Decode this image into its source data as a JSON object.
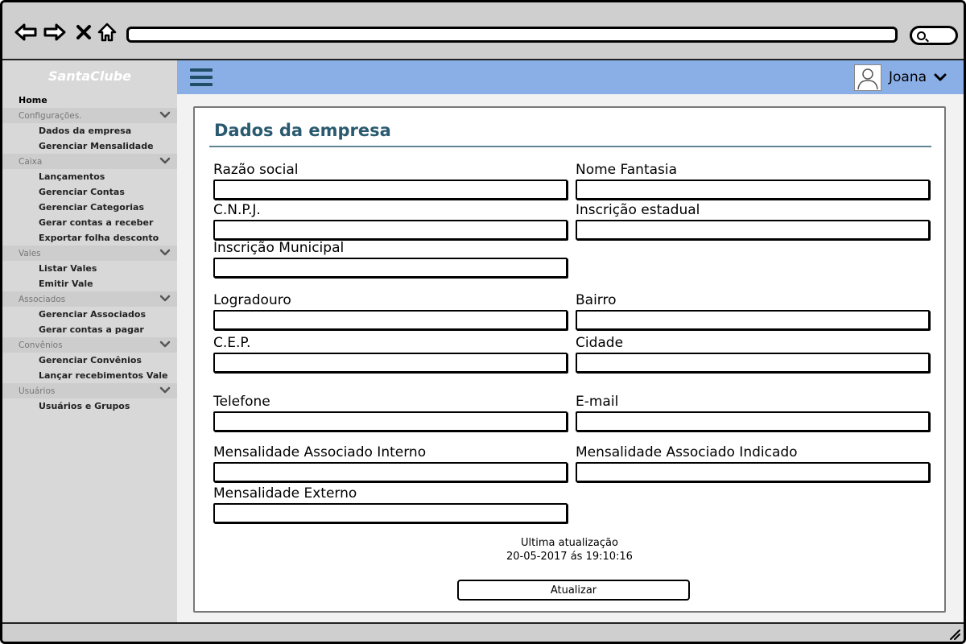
{
  "app": {
    "brand": "SantaClube"
  },
  "browser": {
    "url": ""
  },
  "user": {
    "name": "Joana"
  },
  "sidebar": {
    "items": [
      {
        "label": "Home",
        "type": "top"
      },
      {
        "label": "Configurações.",
        "type": "section",
        "expandable": true
      },
      {
        "label": "Dados da empresa",
        "type": "sub"
      },
      {
        "label": "Gerenciar Mensalidade",
        "type": "sub"
      },
      {
        "label": "Caixa",
        "type": "section",
        "expandable": true
      },
      {
        "label": "Lançamentos",
        "type": "sub"
      },
      {
        "label": "Gerenciar Contas",
        "type": "sub"
      },
      {
        "label": "Gerenciar Categorias",
        "type": "sub"
      },
      {
        "label": "Gerar contas a receber",
        "type": "sub"
      },
      {
        "label": "Exportar folha desconto",
        "type": "sub"
      },
      {
        "label": "Vales",
        "type": "section",
        "expandable": true
      },
      {
        "label": "Listar Vales",
        "type": "sub"
      },
      {
        "label": "Emitir Vale",
        "type": "sub"
      },
      {
        "label": "Associados",
        "type": "section",
        "expandable": true
      },
      {
        "label": "Gerenciar Associados",
        "type": "sub"
      },
      {
        "label": "Gerar contas a pagar",
        "type": "sub"
      },
      {
        "label": "Convênios",
        "type": "section",
        "expandable": true
      },
      {
        "label": "Gerenciar Convênios",
        "type": "sub"
      },
      {
        "label": "Lançar recebimentos Vale",
        "type": "sub"
      },
      {
        "label": "Usuários",
        "type": "section",
        "expandable": true
      },
      {
        "label": "Usuários e Grupos",
        "type": "sub"
      }
    ]
  },
  "form": {
    "title": "Dados da empresa",
    "fields": {
      "razao_social": {
        "label": "Razão social",
        "value": ""
      },
      "nome_fantasia": {
        "label": "Nome Fantasia",
        "value": ""
      },
      "cnpj": {
        "label": "C.N.P.J.",
        "value": ""
      },
      "inscricao_estadual": {
        "label": "Inscrição estadual",
        "value": ""
      },
      "inscricao_municipal": {
        "label": "Inscrição Municipal",
        "value": ""
      },
      "logradouro": {
        "label": "Logradouro",
        "value": ""
      },
      "bairro": {
        "label": "Bairro",
        "value": ""
      },
      "cep": {
        "label": "C.E.P.",
        "value": ""
      },
      "cidade": {
        "label": "Cidade",
        "value": ""
      },
      "telefone": {
        "label": "Telefone",
        "value": ""
      },
      "email": {
        "label": "E-mail",
        "value": ""
      },
      "mens_interno": {
        "label": "Mensalidade Associado Interno",
        "value": ""
      },
      "mens_indicado": {
        "label": "Mensalidade Associado Indicado",
        "value": ""
      },
      "mens_externo": {
        "label": "Mensalidade Externo",
        "value": ""
      }
    },
    "last_update_label": "Ultima atualização",
    "last_update_value": "20-05-2017 ás 19:10:16",
    "update_button": "Atualizar"
  },
  "colors": {
    "topbar": "#8aaee6",
    "title": "#2a5a6f",
    "sidebar": "#d8d8d8"
  }
}
